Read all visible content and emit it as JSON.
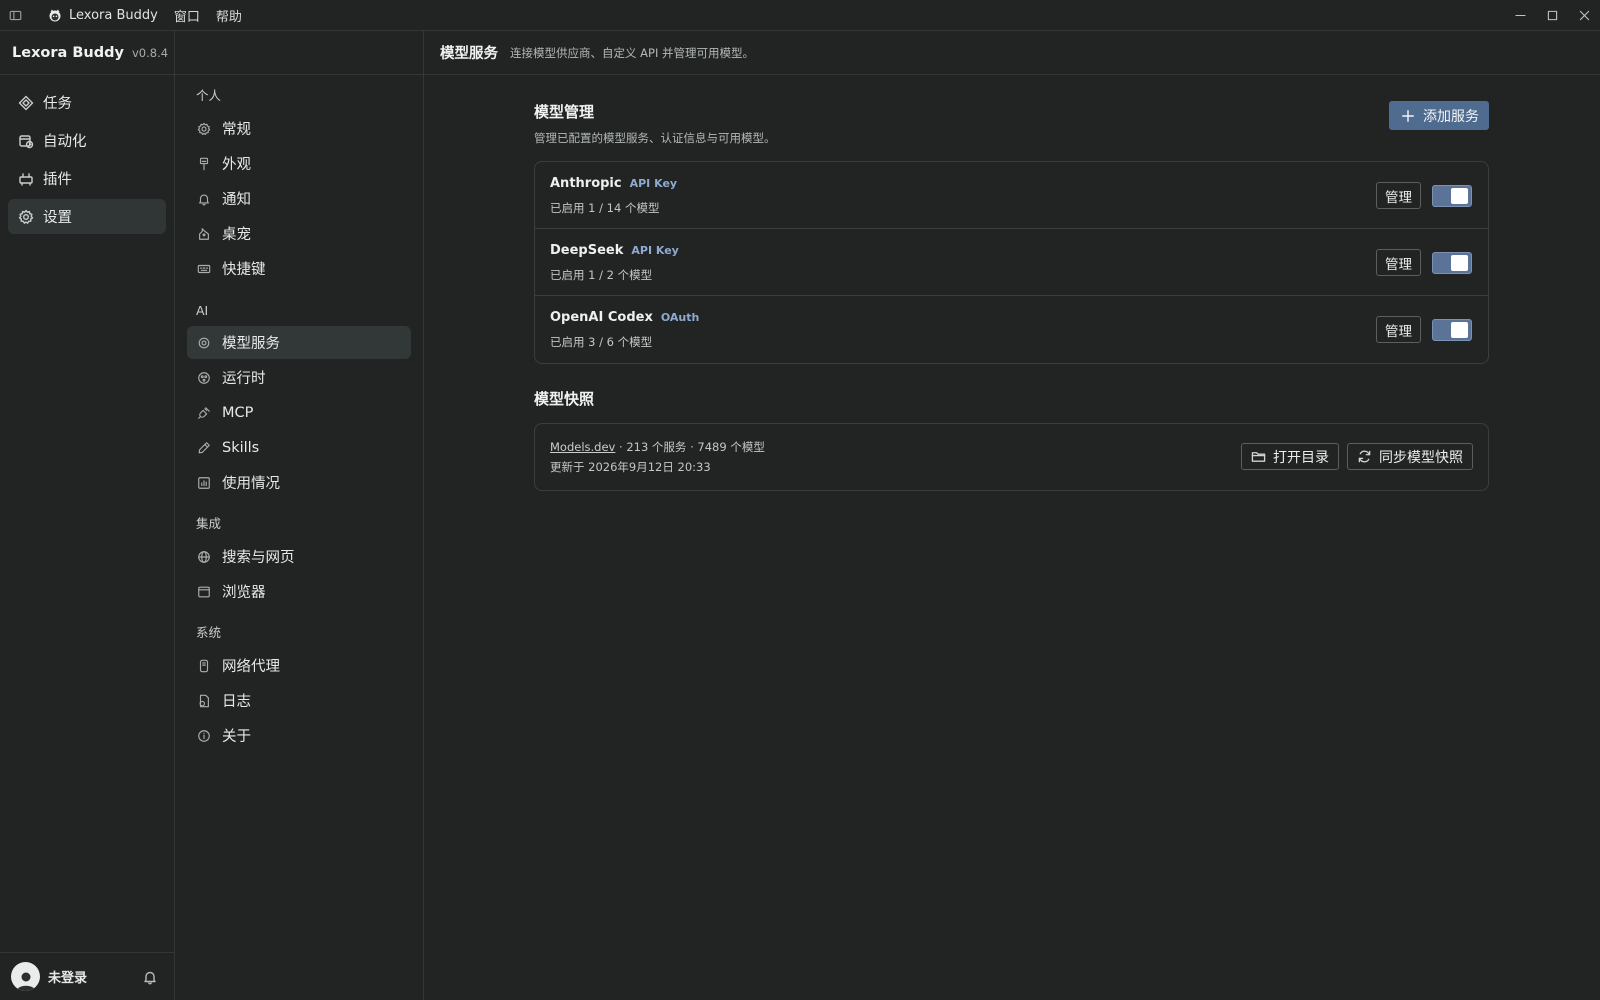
{
  "titlebar": {
    "app_name": "Lexora Buddy",
    "menus": [
      "窗口",
      "帮助"
    ]
  },
  "rail": {
    "brand": "Lexora Buddy",
    "version": "v0.8.4",
    "items": [
      {
        "label": "任务",
        "icon": "diamond-icon"
      },
      {
        "label": "自动化",
        "icon": "calendar-clock-icon"
      },
      {
        "label": "插件",
        "icon": "plugin-icon"
      },
      {
        "label": "设置",
        "icon": "gear-icon",
        "active": true
      }
    ],
    "user": "未登录"
  },
  "settings_nav": {
    "groups": [
      {
        "label": "个人",
        "items": [
          {
            "label": "常规",
            "icon": "gear-icon"
          },
          {
            "label": "外观",
            "icon": "brush-icon"
          },
          {
            "label": "通知",
            "icon": "bell-icon"
          },
          {
            "label": "桌宠",
            "icon": "pet-icon"
          },
          {
            "label": "快捷键",
            "icon": "keyboard-icon"
          }
        ]
      },
      {
        "label": "AI",
        "items": [
          {
            "label": "模型服务",
            "icon": "model-icon",
            "active": true
          },
          {
            "label": "运行时",
            "icon": "runtime-icon"
          },
          {
            "label": "MCP",
            "icon": "plug-icon"
          },
          {
            "label": "Skills",
            "icon": "pen-icon"
          },
          {
            "label": "使用情况",
            "icon": "chart-icon"
          }
        ]
      },
      {
        "label": "集成",
        "items": [
          {
            "label": "搜索与网页",
            "icon": "globe-icon"
          },
          {
            "label": "浏览器",
            "icon": "browser-icon"
          }
        ]
      },
      {
        "label": "系统",
        "items": [
          {
            "label": "网络代理",
            "icon": "proxy-icon"
          },
          {
            "label": "日志",
            "icon": "log-icon"
          },
          {
            "label": "关于",
            "icon": "info-icon"
          }
        ]
      }
    ]
  },
  "content": {
    "title": "模型服务",
    "subtitle": "连接模型供应商、自定义 API 并管理可用模型。",
    "management": {
      "title": "模型管理",
      "description": "管理已配置的模型服务、认证信息与可用模型。",
      "add_button": "添加服务",
      "providers": [
        {
          "name": "Anthropic",
          "auth": "API Key",
          "count": "已启用 1 / 14 个模型",
          "manage": "管理",
          "enabled": true
        },
        {
          "name": "DeepSeek",
          "auth": "API Key",
          "count": "已启用 1 / 2 个模型",
          "manage": "管理",
          "enabled": true
        },
        {
          "name": "OpenAI Codex",
          "auth": "OAuth",
          "count": "已启用 3 / 6 个模型",
          "manage": "管理",
          "enabled": true
        }
      ]
    },
    "snapshot": {
      "title": "模型快照",
      "source": "Models.dev",
      "stats": " · 213 个服务 · 7489 个模型",
      "updated": "更新于 2026年9月12日 20:33",
      "open_dir": "打开目录",
      "sync": "同步模型快照"
    }
  },
  "colors": {
    "background": "#212423",
    "accent": "#4f6b8f",
    "toggle_on": "#5b7396",
    "auth_badge": "#8eaad0"
  }
}
